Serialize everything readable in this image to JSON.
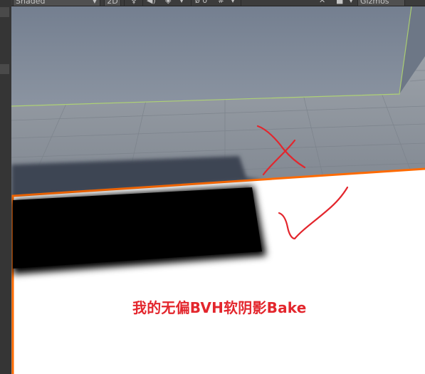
{
  "toolbar": {
    "shading_mode": "Shaded",
    "view_2d_label": "2D",
    "light_icon": "light-bulb-icon",
    "audio_icon": "speaker-icon",
    "effects_icon": "layers-icon",
    "hidden_count": "0",
    "grid_icon": "grid-icon",
    "tools_icon": "tools-icon",
    "camera_icon": "camera-icon",
    "gizmos_label": "Gizmos"
  },
  "annotation": {
    "caption": "我的无偏BVH软阴影Bake",
    "color": "#e3262d",
    "marks": [
      "cross",
      "check"
    ]
  },
  "scene": {
    "wall_color": "#7c8797",
    "ground_color": "#8d939b",
    "bake_plane_color": "#ffffff",
    "selection_outline_color": "#ff6a00",
    "shadow_color": "#000000"
  }
}
